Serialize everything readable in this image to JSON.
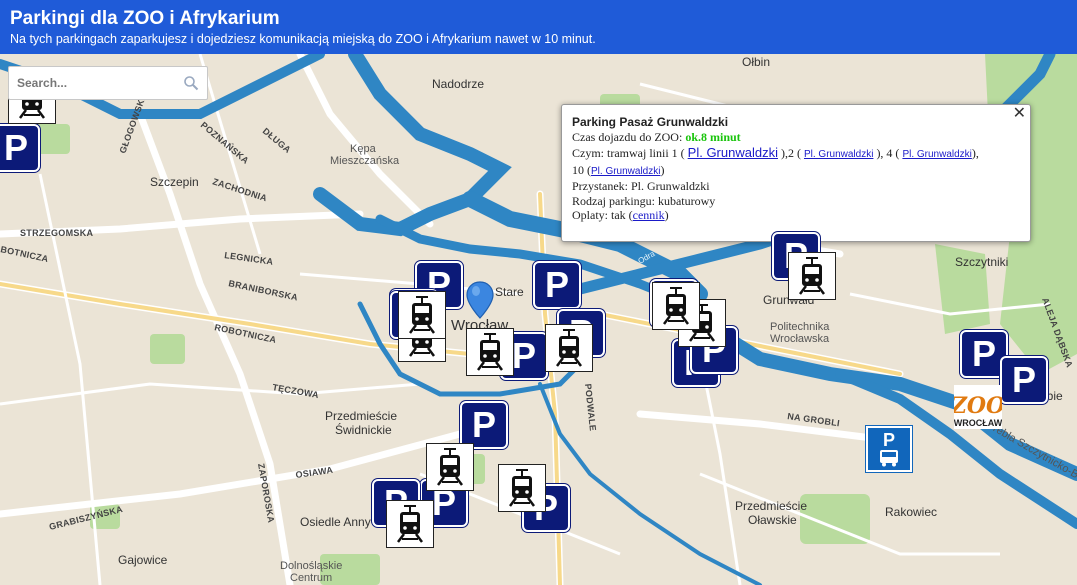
{
  "header": {
    "title": "Parkingi dla ZOO i Afrykarium",
    "subtitle": "Na tych parkingach zaparkujesz i dojedziesz komunikacją miejską do ZOO i Afrykarium nawet w 10 minut."
  },
  "search": {
    "placeholder": "Search..."
  },
  "map_labels": {
    "olbin": "Ołbin",
    "nadodrze": "Nadodrze",
    "kepa1": "Kępa",
    "kepa2": "Mieszczańska",
    "szczepin": "Szczepin",
    "glogowska": "GŁOGOWSKA",
    "poznanska": "POZNAŃSKA",
    "dluga": "DŁUGA",
    "zachodnia": "ZACHODNIA",
    "strzegomska": "STRZEGOMSKA",
    "botnicza": "BOTNICZA",
    "legnicka": "LEGNICKA",
    "braniborska": "BRANIBORSKA",
    "robotnicza": "ROBOTNICZA",
    "teczowa": "TĘCZOWA",
    "przedmiescie_sw1": "Przedmieście",
    "przedmiescie_sw2": "Świdnickie",
    "osiawa": "OSIAWA",
    "zaporoska": "ZAPOROSKA",
    "grabiszynska": "GRABISZYŃSKA",
    "osiedle_anny": "Osiedle Anny",
    "gajowice": "Gajowice",
    "dolnoslaskie1": "Dolnośląskie",
    "dolnoslaskie2": "Centrum",
    "stare": "Stare",
    "wroclaw": "Wrocław",
    "grunwald": "Grunwałd",
    "politechnika1": "Politechnika",
    "politechnika2": "Wrocławska",
    "na_grobli": "NA GROBLI",
    "przedmiescie_ol1": "Przedmieście",
    "przedmiescie_ol2": "Oławskie",
    "rakowiec": "Rakowiec",
    "szczytniki": "Szczytniki",
    "aleja": "ALEJA DĄBSKA",
    "grebla": "Grebla Szczytnicko-Bart",
    "podwale": "PODWALE",
    "odra": "Odra",
    "sebie": "ąbie"
  },
  "popup": {
    "title": "Parking Pasaż Grunwaldzki",
    "time_label": "Czas dojazdu do ZOO:",
    "time_value": "ok.8 minut",
    "czym_prefix": "Czym: tramwaj linii 1 (",
    "link_main": "Pl. Grunwaldzki",
    "czym_mid1": "),2 (",
    "link2": "Pl. Grunwaldzki",
    "czym_mid2": "), 4 (",
    "link3": "Pl. Grunwaldzki",
    "czym_mid3": "),",
    "czym_line2_prefix": "10 (",
    "link4": "Pl. Grunwaldzki",
    "czym_line2_suffix": ")",
    "przystanek": "Przystanek: Pl. Grunwaldzki",
    "rodzaj": "Rodzaj parkingu: kubaturowy",
    "oplaty_prefix": "Oplaty: tak (",
    "cennik": "cennik",
    "oplaty_suffix": ")",
    "close": "✕"
  },
  "markers": {
    "parking_label": "P",
    "zoo_logo_text": "ZOO",
    "zoo_logo_sub": "WROCŁAW",
    "bus_label": "P"
  },
  "colors": {
    "header_bg": "#1f5bd8",
    "parking_marker": "#0c1a78",
    "water": "#2f86c4",
    "park": "#b5d89a",
    "pin": "#3b86e0",
    "link": "#1a1ac8",
    "time_green": "#19c40b"
  }
}
